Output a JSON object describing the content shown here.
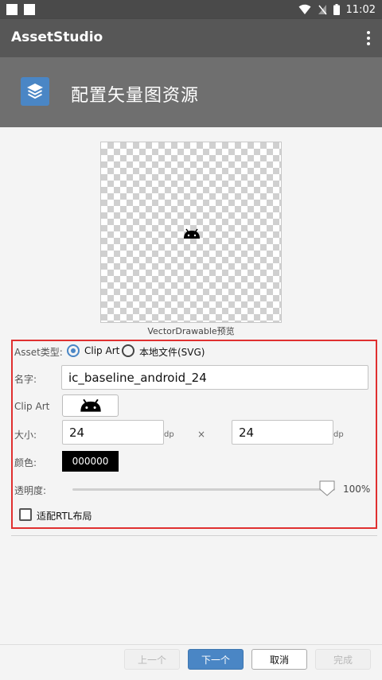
{
  "status_bar": {
    "time": "11:02"
  },
  "app_bar": {
    "title": "AssetStudio",
    "overflow_icon": "more-vert-icon"
  },
  "header": {
    "title": "配置矢量图资源",
    "icon": "layers-icon",
    "icon_color": "#4a86c5"
  },
  "preview": {
    "caption": "VectorDrawable预览",
    "icon": "android-icon"
  },
  "form": {
    "asset_type_label": "Asset类型:",
    "asset_type_options": [
      "Clip Art",
      "本地文件(SVG)"
    ],
    "asset_type_selected": "Clip Art",
    "name_label": "名字:",
    "name_value": "ic_baseline_android_24",
    "clip_art_label": "Clip Art",
    "clip_art_icon": "android-icon",
    "size_label": "大小:",
    "width_value": "24",
    "height_value": "24",
    "unit": "dp",
    "times": "×",
    "color_label": "颜色:",
    "color_value": "000000",
    "opacity_label": "透明度:",
    "opacity_percent": "100%",
    "opacity_value": 100,
    "rtl_label": "适配RTL布局",
    "rtl_checked": false
  },
  "footer": {
    "prev_label": "上一个",
    "next_label": "下一个",
    "cancel_label": "取消",
    "finish_label": "完成"
  },
  "colors": {
    "accent": "#4a86c5",
    "highlight_border": "#e03030",
    "app_bar": "#575757",
    "header": "#6f6f6f"
  }
}
